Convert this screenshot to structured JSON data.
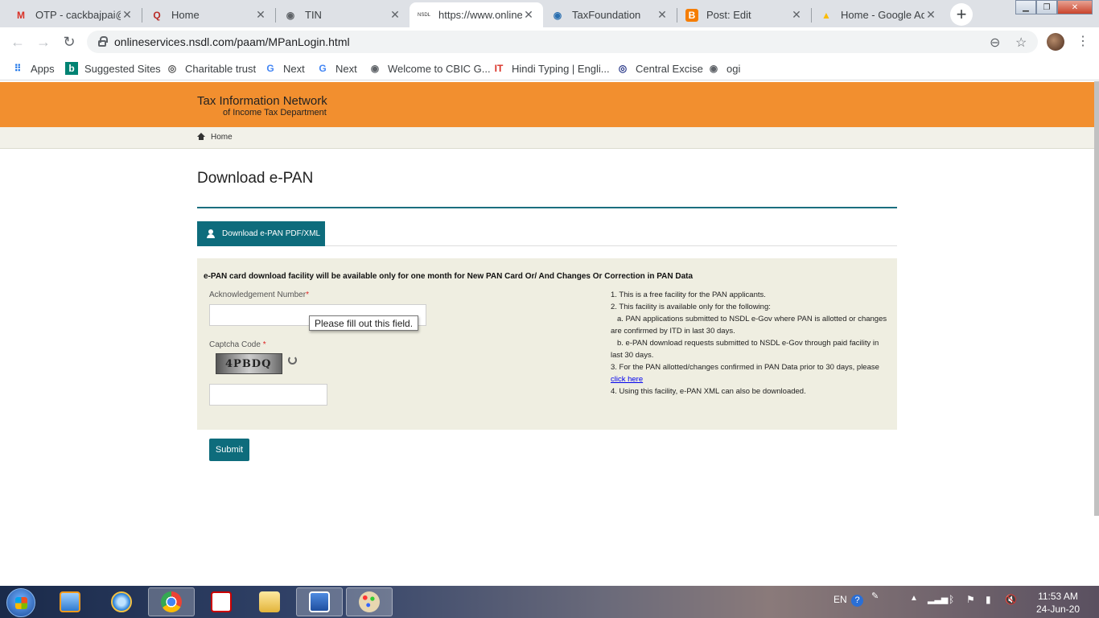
{
  "browser": {
    "tabs": [
      {
        "title": "OTP - cackbajpai@",
        "icon": "gmail-icon",
        "color": "#d93025",
        "glyph": "M"
      },
      {
        "title": "Home",
        "icon": "quora-icon",
        "color": "#b92b27",
        "glyph": "Q"
      },
      {
        "title": "TIN",
        "icon": "globe-icon",
        "color": "#5f6368",
        "glyph": "◉"
      },
      {
        "title": "https://www.online",
        "icon": "nsdl-icon",
        "color": "#333333",
        "glyph": "NSDL",
        "active": true
      },
      {
        "title": "TaxFoundation",
        "icon": "globe-icon",
        "color": "#2a6fb0",
        "glyph": "◉"
      },
      {
        "title": "Post: Edit",
        "icon": "blogger-icon",
        "color": "#f57d00",
        "glyph": "B"
      },
      {
        "title": "Home - Google Ad",
        "icon": "google-ads-icon",
        "color": "#fbbc04",
        "glyph": "▲"
      }
    ],
    "url": "onlineservices.nsdl.com/paam/MPanLogin.html",
    "bookmarks": [
      {
        "label": "Apps",
        "icon": "apps-grid-icon",
        "glyph": "⋮⋮",
        "color": "#1a73e8"
      },
      {
        "label": "Suggested Sites",
        "icon": "bing-icon",
        "glyph": "b",
        "color": "#008373"
      },
      {
        "label": "Charitable trust",
        "icon": "emblem-icon",
        "glyph": "◎",
        "color": "#555555"
      },
      {
        "label": "Next",
        "icon": "google-icon",
        "glyph": "G",
        "color": "#4285f4"
      },
      {
        "label": "Next",
        "icon": "google-icon",
        "glyph": "G",
        "color": "#4285f4"
      },
      {
        "label": "Welcome to CBIC G...",
        "icon": "globe-icon",
        "glyph": "◉",
        "color": "#5f6368"
      },
      {
        "label": "Hindi Typing | Engli...",
        "icon": "it-icon",
        "glyph": "IT",
        "color": "#d93025"
      },
      {
        "label": "Central Excise",
        "icon": "emblem-icon",
        "glyph": "◎",
        "color": "#2b3a8a"
      },
      {
        "label": "ogi",
        "icon": "globe-icon",
        "glyph": "◉",
        "color": "#5f6368"
      }
    ]
  },
  "site": {
    "header_title": "Tax Information Network",
    "header_sub": "of Income Tax Department",
    "breadcrumb": "Home"
  },
  "form": {
    "page_title": "Download e-PAN",
    "tab_label": "Download e-PAN PDF/XML",
    "notice": "e-PAN card download facility will be available only for one month for New PAN Card Or/ And Changes Or Correction in PAN Data",
    "ack_label": "Acknowledgement Number",
    "required_mark": "*",
    "ack_value": "",
    "tooltip": "Please fill out this field.",
    "captcha_label": "Captcha Code",
    "captcha_text": "4PBDQ",
    "captcha_value": "",
    "submit_label": "Submit",
    "info": {
      "l1": "1. This is a free facility for the PAN applicants.",
      "l2": "2. This facility is available only for the following:",
      "l2a": "a. PAN applications submitted to NSDL e-Gov where PAN is allotted or changes are confirmed by ITD in last 30 days.",
      "l2b": "b. e-PAN download requests submitted to NSDL e-Gov through paid facility in last 30 days.",
      "l3_pre": "3. For the PAN allotted/changes confirmed in PAN Data prior to 30 days, please ",
      "l3_link": "click here",
      "l4": "4. Using this facility, e-PAN XML can also be downloaded."
    }
  },
  "taskbar": {
    "lang": "EN",
    "time": "11:53 AM",
    "date": "24-Jun-20"
  }
}
